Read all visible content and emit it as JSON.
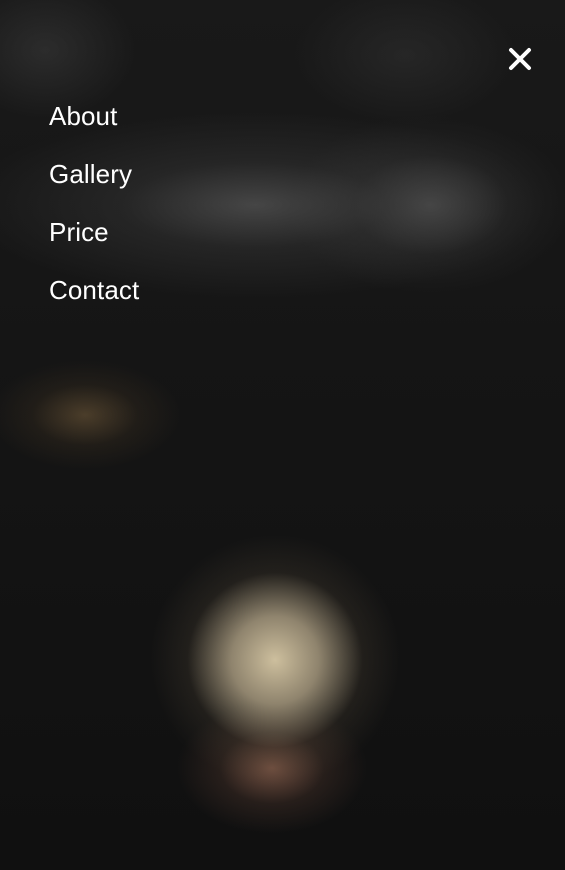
{
  "menu": {
    "items": [
      {
        "label": "About"
      },
      {
        "label": "Gallery"
      },
      {
        "label": "Price"
      },
      {
        "label": "Contact"
      }
    ]
  },
  "close_button": {
    "icon": "close-icon",
    "color": "#ffffff"
  },
  "colors": {
    "background": "#111111",
    "text": "#ffffff"
  }
}
